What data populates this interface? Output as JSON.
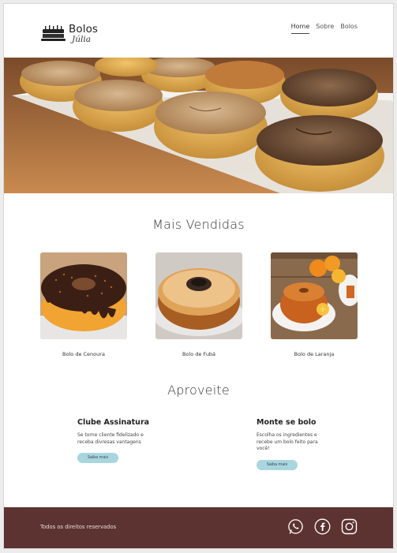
{
  "brand": {
    "name": "Bolos",
    "tagline": "Júlia",
    "icon": "cake-icon"
  },
  "nav": [
    {
      "label": "Home",
      "active": true
    },
    {
      "label": "Sobre",
      "active": false
    },
    {
      "label": "Bolos",
      "active": false
    }
  ],
  "hero": {
    "image": "hero-cakes-photo"
  },
  "best_sellers": {
    "title": "Mais Vendidas",
    "products": [
      {
        "name": "Bolo de  Cenoura",
        "image": "carrot-cake-photo"
      },
      {
        "name": "Bolo de  Fubá",
        "image": "cornmeal-cake-photo"
      },
      {
        "name": "Bolo de Laranja",
        "image": "orange-cake-photo"
      }
    ]
  },
  "offers_section": {
    "title": "Aproveite",
    "offers": [
      {
        "title": "Clube Assinatura",
        "text": "Se torne cliente fidelizado e receba divresas vantagens",
        "button": "Saiba mais"
      },
      {
        "title": "Monte se bolo",
        "text": "Escolha os ingredientes e recebe um bolo feito para você!",
        "button": "Saiba mais"
      }
    ]
  },
  "footer": {
    "copyright": "Todos os direitos reservados",
    "socials": [
      "whatsapp-icon",
      "facebook-icon",
      "instagram-icon"
    ]
  },
  "colors": {
    "footer_bg": "#5c3330",
    "button_bg": "#a9d6de",
    "accent_text": "#222222"
  }
}
